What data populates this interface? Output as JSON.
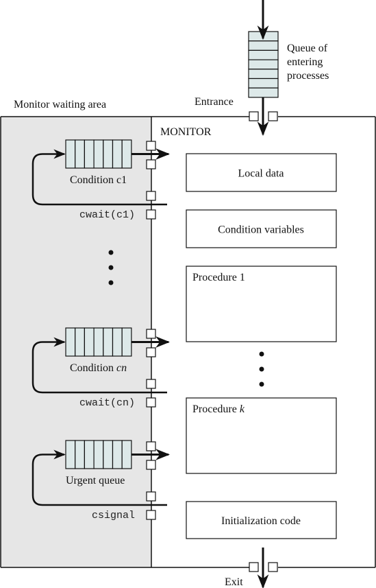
{
  "labels": {
    "monitor_waiting_area": "Monitor waiting area",
    "entrance": "Entrance",
    "monitor": "MONITOR",
    "queue_entering_line1": "Queue of",
    "queue_entering_line2": "entering",
    "queue_entering_line3": "processes",
    "exit": "Exit"
  },
  "waiting_queues": [
    {
      "name_prefix": "Condition ",
      "name_var": "c1",
      "var_italic": false,
      "operation": "cwait(c1)"
    },
    {
      "name_prefix": "Condition ",
      "name_var": "cn",
      "var_italic": true,
      "operation": "cwait(cn)"
    },
    {
      "name_prefix": "Urgent queue",
      "name_var": "",
      "var_italic": false,
      "operation": "csignal"
    }
  ],
  "monitor_components": [
    {
      "label": "Local data",
      "italic_suffix": ""
    },
    {
      "label": "Condition variables",
      "italic_suffix": ""
    },
    {
      "label": "Procedure 1",
      "italic_suffix": ""
    },
    {
      "label": "Procedure ",
      "italic_suffix": "k"
    },
    {
      "label": "Initialization code",
      "italic_suffix": ""
    }
  ],
  "colors": {
    "waiting_area_fill": "#e6e6e6",
    "queue_cell_fill": "#dde9e9",
    "stroke": "#111111"
  }
}
